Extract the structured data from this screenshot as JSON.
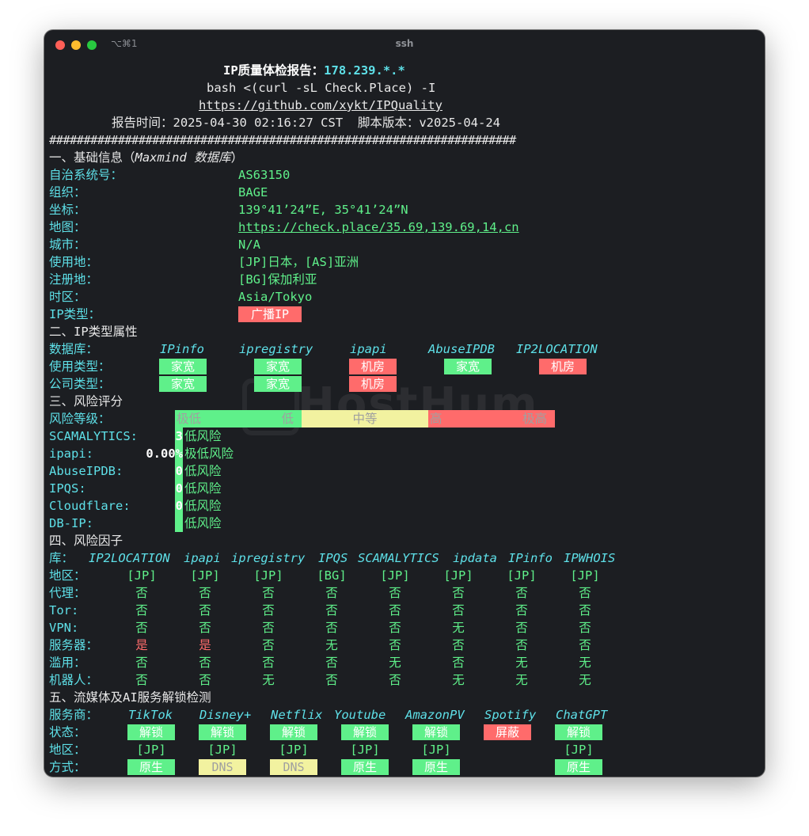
{
  "window": {
    "shortcut": "⌥⌘1",
    "title": "ssh"
  },
  "header": {
    "title_label": "IP质量体检报告：",
    "ip": "178.239.*.*",
    "command": "bash <(curl -sL Check.Place) -I",
    "url": "https://github.com/xykt/IPQuality",
    "report_time_label": "报告时间：",
    "report_time": "2025-04-30 02:16:27 CST",
    "version_label": "脚本版本：",
    "version": "v2025-04-24",
    "separator": "####################################################################"
  },
  "section1": {
    "title": "一、基础信息（",
    "title_db": "Maxmind 数据库",
    "title_end": "）",
    "rows": [
      {
        "label": "自治系统号：",
        "value": "AS63150"
      },
      {
        "label": "组织：",
        "value": "BAGE"
      },
      {
        "label": "坐标：",
        "value": "139°41’24”E, 35°41’24”N"
      },
      {
        "label": "地图：",
        "value": "https://check.place/35.69,139.69,14,cn"
      },
      {
        "label": "城市：",
        "value": "N/A"
      },
      {
        "label": "使用地：",
        "value": "[JP]日本，[AS]亚洲"
      },
      {
        "label": "注册地：",
        "value": "[BG]保加利亚"
      },
      {
        "label": "时区：",
        "value": "Asia/Tokyo"
      },
      {
        "label": "IP类型：",
        "value": "广播IP"
      }
    ]
  },
  "section2": {
    "title": "二、IP类型属性",
    "db_label": "数据库：",
    "databases": [
      "IPinfo",
      "ipregistry",
      "ipapi",
      "AbuseIPDB",
      "IP2LOCATION"
    ],
    "usage_label": "使用类型：",
    "usage": [
      "家宽",
      "家宽",
      "机房",
      "家宽",
      "机房"
    ],
    "company_label": "公司类型：",
    "company": [
      "家宽",
      "家宽",
      "机房"
    ]
  },
  "section3": {
    "title": "三、风险评分",
    "level_label": "风险等级：",
    "levels": [
      "极低",
      "低",
      "中等",
      "高",
      "极高"
    ],
    "scores": [
      {
        "label": "SCAMALYTICS:",
        "value": "3",
        "text": "低风险"
      },
      {
        "label": "ipapi:",
        "value": "0.00%",
        "text": "极低风险"
      },
      {
        "label": "AbuseIPDB:",
        "value": "0",
        "text": "低风险"
      },
      {
        "label": "IPQS:",
        "value": "0",
        "text": "低风险"
      },
      {
        "label": "Cloudflare:",
        "value": "0",
        "text": "低风险"
      },
      {
        "label": "DB-IP:",
        "value": "",
        "text": "低风险"
      }
    ]
  },
  "section4": {
    "title": "四、风险因子",
    "lib_label": "库：",
    "libs": [
      "IP2LOCATION",
      "ipapi",
      "ipregistry",
      "IPQS",
      "SCAMALYTICS",
      "ipdata",
      "IPinfo",
      "IPWHOIS"
    ],
    "rows": [
      {
        "label": "地区：",
        "values": [
          "[JP]",
          "[JP]",
          "[JP]",
          "[BG]",
          "[JP]",
          "[JP]",
          "[JP]",
          "[JP]"
        ]
      },
      {
        "label": "代理：",
        "values": [
          "否",
          "否",
          "否",
          "否",
          "否",
          "否",
          "否",
          "否"
        ]
      },
      {
        "label": "Tor:",
        "values": [
          "否",
          "否",
          "否",
          "否",
          "否",
          "否",
          "否",
          "否"
        ]
      },
      {
        "label": "VPN:",
        "values": [
          "否",
          "否",
          "否",
          "否",
          "否",
          "无",
          "否",
          "否"
        ]
      },
      {
        "label": "服务器：",
        "values": [
          "是",
          "是",
          "否",
          "无",
          "否",
          "否",
          "否",
          "否"
        ]
      },
      {
        "label": "滥用：",
        "values": [
          "否",
          "否",
          "否",
          "否",
          "无",
          "否",
          "无",
          "无"
        ]
      },
      {
        "label": "机器人：",
        "values": [
          "否",
          "否",
          "无",
          "否",
          "否",
          "无",
          "无",
          "无"
        ]
      }
    ]
  },
  "section5": {
    "title": "五、流媒体及AI服务解锁检测",
    "service_label": "服务商：",
    "services": [
      "TikTok",
      "Disney+",
      "Netflix",
      "Youtube",
      "AmazonPV",
      "Spotify",
      "ChatGPT"
    ],
    "status_label": "状态：",
    "status": [
      "解锁",
      "解锁",
      "解锁",
      "解锁",
      "解锁",
      "屏蔽",
      "解锁"
    ],
    "region_label": "地区：",
    "regions": [
      "[JP]",
      "[JP]",
      "[JP]",
      "[JP]",
      "[JP]",
      "",
      "[JP]"
    ],
    "method_label": "方式：",
    "methods": [
      "原生",
      "DNS",
      "DNS",
      "原生",
      "原生",
      "",
      "原生"
    ]
  },
  "watermark": "HostHum",
  "colors": {
    "background": "#1c1e22",
    "green": "#5ff08a",
    "red": "#ff6b6b",
    "cyan": "#5ee0e8",
    "yellow": "#f2f2a0"
  }
}
